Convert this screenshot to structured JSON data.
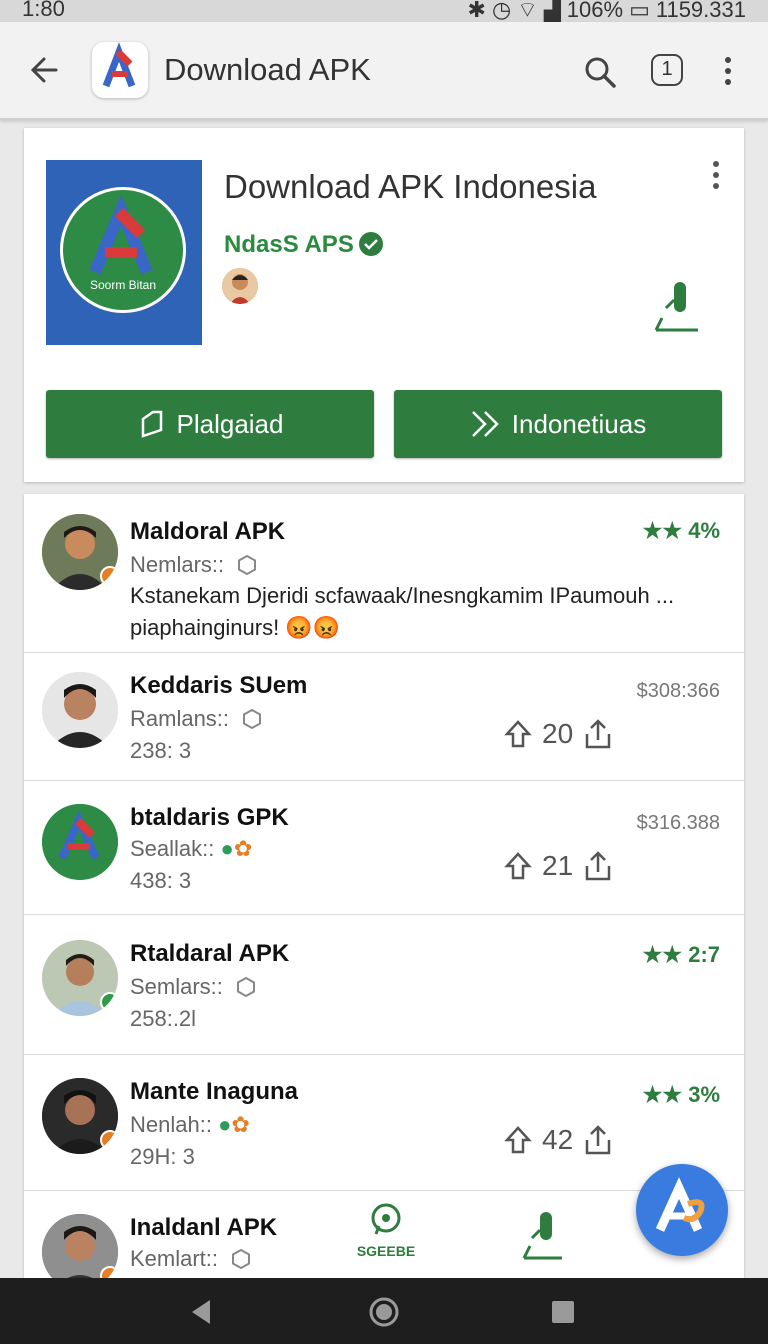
{
  "status_bar": {
    "time": "1:80",
    "battery": "106%",
    "right_text": "1159.331"
  },
  "app_bar": {
    "title": "Download APK",
    "badge": "1"
  },
  "hero": {
    "app_name": "Download APK Indonesia",
    "developer": "NdasS APS",
    "icon_text": "Soorm Bitan",
    "buttons": [
      {
        "label": "Plalgaiad"
      },
      {
        "label": "Indonetiuas"
      }
    ]
  },
  "reviews": [
    {
      "name": "Maldoral APK",
      "meta": "Nemlars::",
      "stars": "4%",
      "comment": "Kstanekam Djeridi scfawaak/Inesngkamim IPaumouh ... piaphainginurs! 😡😡"
    },
    {
      "name": "Keddaris SUem",
      "meta": "Ramlans::",
      "meta2": "238: 3",
      "size": "$308:366",
      "votes": "20"
    },
    {
      "name": "btaldaris GPK",
      "meta": "Seallak::",
      "meta2": "438: 3",
      "size": "$316.388",
      "votes": "21"
    },
    {
      "name": "Rtaldaral APK",
      "meta": "Semlars::",
      "meta2": "258:.2l",
      "stars": "2:7"
    },
    {
      "name": "Mante Inaguna",
      "meta": "Nenlah::",
      "meta2": "29H: 3",
      "stars": "3%",
      "votes": "42"
    },
    {
      "name": "Inaldanl APK",
      "meta": "Kemlart::",
      "share_label": "SGEEBE"
    }
  ],
  "colors": {
    "green": "#2e7d3e",
    "blue": "#2f63b8",
    "fab": "#3a7be0"
  }
}
